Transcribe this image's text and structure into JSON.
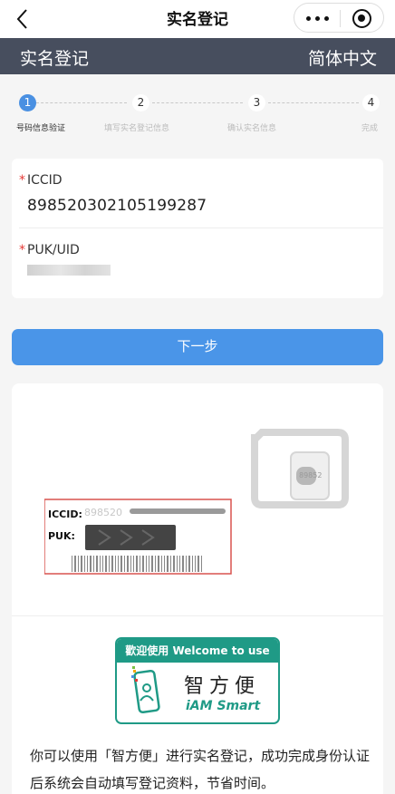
{
  "topbar": {
    "title": "实名登记"
  },
  "header": {
    "title": "实名登记",
    "language": "简体中文"
  },
  "steps": [
    {
      "number": "1",
      "label": "号码信息验证"
    },
    {
      "number": "2",
      "label": "填写实名登记信息"
    },
    {
      "number": "3",
      "label": "确认实名信息"
    },
    {
      "number": "4",
      "label": "完成"
    }
  ],
  "form": {
    "iccid_label": "ICCID",
    "iccid_value": "898520302105199287",
    "puk_label": "PUK/UID",
    "required_mark": "*"
  },
  "next_button": "下一步",
  "sim_card": {
    "iccid_label": "ICCID:",
    "puk_label": "PUK:",
    "iccid_prefix": "898520",
    "chip_text": "89852"
  },
  "logo": {
    "top_text": "歡迎使用 Welcome to use",
    "cn_text": "智方便",
    "en_text": "iAM Smart"
  },
  "description": "你可以使用「智方便」进行实名登记，成功完成身份认证后系统会自动填写登记资料，节省时间。",
  "colors": {
    "accent": "#4a90e2",
    "header_bg": "#474e5e",
    "logo_green": "#1f9a86",
    "required": "#e53935"
  }
}
